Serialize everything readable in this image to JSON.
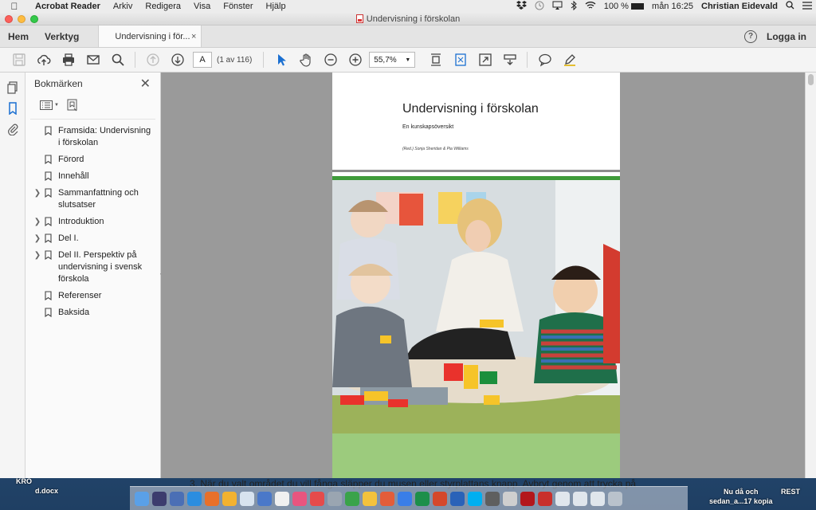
{
  "menubar": {
    "app": "Acrobat Reader",
    "menus": [
      "Arkiv",
      "Redigera",
      "Visa",
      "Fönster",
      "Hjälp"
    ],
    "battery": "100 %",
    "clock": "mån 16:25",
    "user": "Christian Eidevald"
  },
  "window": {
    "title": "Undervisning i förskolan"
  },
  "tabs": {
    "home": "Hem",
    "tools": "Verktyg",
    "doc_tab": "Undervisning i för...",
    "close": "×",
    "login": "Logga in"
  },
  "toolbar": {
    "page_value": "A",
    "page_of": "(1 av 116)",
    "zoom": "55,7%"
  },
  "bookmarks": {
    "title": "Bokmärken",
    "items": [
      {
        "label": "Framsida: Undervisning i förskolan",
        "expandable": false
      },
      {
        "label": "Förord",
        "expandable": false
      },
      {
        "label": "Innehåll",
        "expandable": false
      },
      {
        "label": "Sammanfattning och slutsatser",
        "expandable": true
      },
      {
        "label": "Introduktion",
        "expandable": true
      },
      {
        "label": "Del I.",
        "expandable": true
      },
      {
        "label": "Del II. Perspektiv på undervisning i svensk förskola",
        "expandable": true
      },
      {
        "label": "Referenser",
        "expandable": false
      },
      {
        "label": "Baksida",
        "expandable": false
      }
    ]
  },
  "document": {
    "title": "Undervisning i förskolan",
    "subtitle": "En kunskapsöversikt",
    "authors": "(Red.) Sonja Sheridan & Pia Williams"
  },
  "desktop": {
    "left_label_1": "KRO",
    "left_label_2": "d.docx",
    "right_label_1": "Nu då och",
    "right_label_2": "sedan_a...17 kopia",
    "far_right_label": "REST",
    "background_text": "3.  När du valt området du vill fånga släpper du musen eller styrplattans knapp. Avbryt genom att trycka på"
  },
  "colors": {
    "accent": "#1a6fd1",
    "green_stripe": "#3f9b3a",
    "green_block": "#9ccb7d"
  }
}
